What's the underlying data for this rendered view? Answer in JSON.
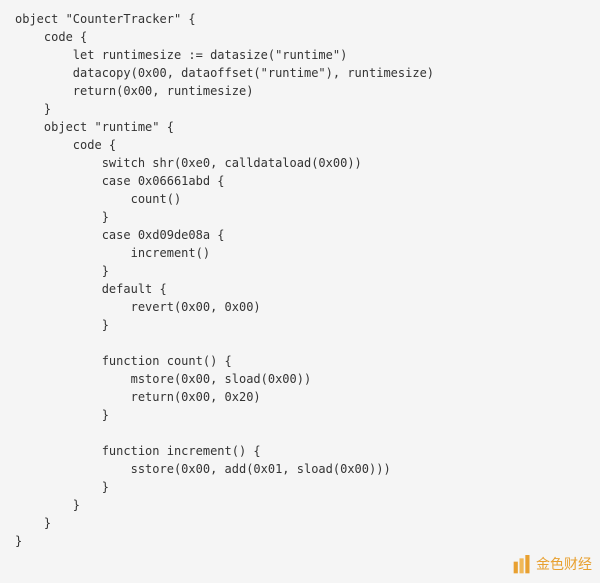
{
  "code": {
    "content": "object \"CounterTracker\" {\n    code {\n        let runtimesize := datasize(\"runtime\")\n        datacopy(0x00, dataoffset(\"runtime\"), runtimesize)\n        return(0x00, runtimesize)\n    }\n    object \"runtime\" {\n        code {\n            switch shr(0xe0, calldataload(0x00))\n            case 0x06661abd {\n                count()\n            }\n            case 0xd09de08a {\n                increment()\n            }\n            default {\n                revert(0x00, 0x00)\n            }\n\n            function count() {\n                mstore(0x00, sload(0x00))\n                return(0x00, 0x20)\n            }\n\n            function increment() {\n                sstore(0x00, add(0x01, sload(0x00)))\n            }\n        }\n    }\n}"
  },
  "watermark": {
    "label": "金色财经"
  }
}
